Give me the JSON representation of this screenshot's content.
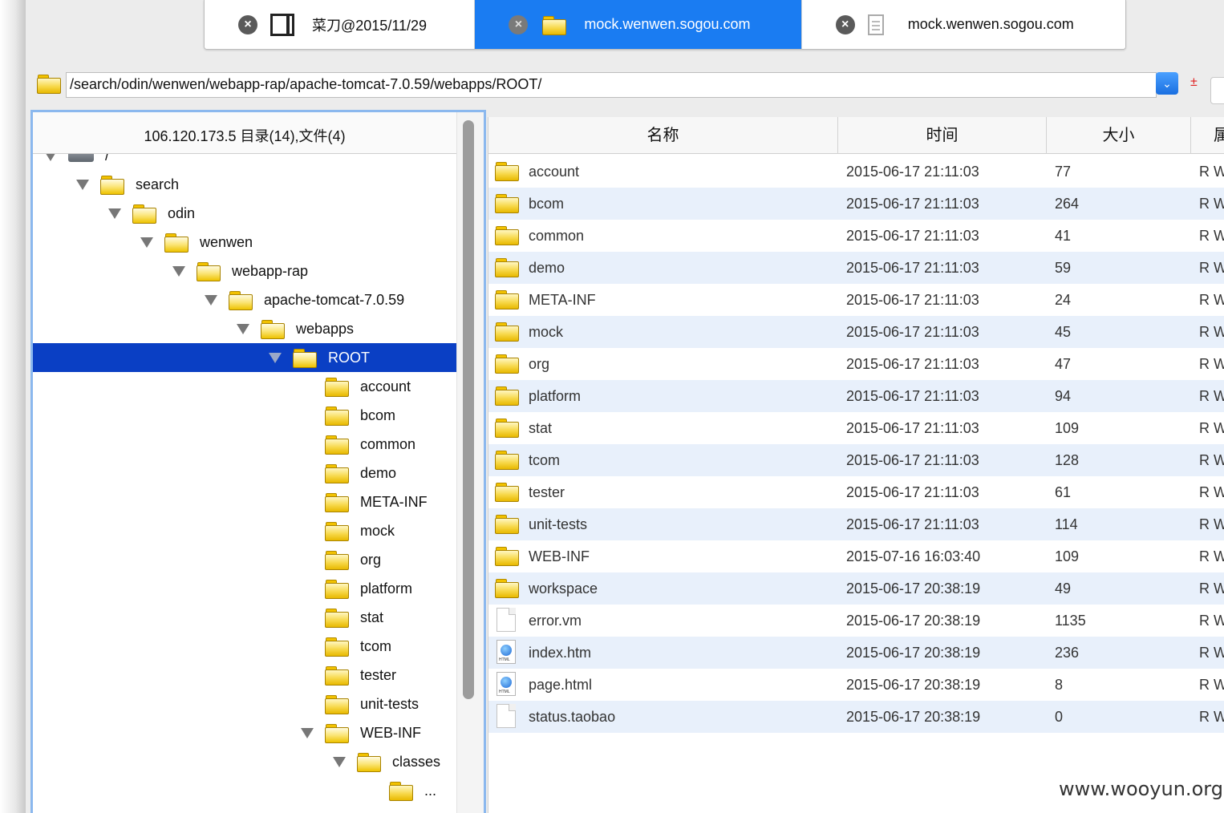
{
  "tabs": [
    {
      "label": "菜刀@2015/11/29",
      "icon": "window-icon",
      "active": false
    },
    {
      "label": "mock.wenwen.sogou.com",
      "icon": "folder-icon",
      "active": true
    },
    {
      "label": "mock.wenwen.sogou.com",
      "icon": "document-icon",
      "active": false
    }
  ],
  "address": {
    "path": "/search/odin/wenwen/webapp-rap/apache-tomcat-7.0.59/webapps/ROOT/",
    "dropdown_glyph": "⌄",
    "plus_glyph": "±"
  },
  "left_panel": {
    "header": "106.120.173.5    目录(14),文件(4)",
    "tree": [
      {
        "label": "/",
        "depth": 0,
        "expanded": true,
        "kind": "server"
      },
      {
        "label": "search",
        "depth": 1,
        "expanded": true
      },
      {
        "label": "odin",
        "depth": 2,
        "expanded": true
      },
      {
        "label": "wenwen",
        "depth": 3,
        "expanded": true
      },
      {
        "label": "webapp-rap",
        "depth": 4,
        "expanded": true
      },
      {
        "label": "apache-tomcat-7.0.59",
        "depth": 5,
        "expanded": true
      },
      {
        "label": "webapps",
        "depth": 6,
        "expanded": true
      },
      {
        "label": "ROOT",
        "depth": 7,
        "expanded": true,
        "selected": true
      },
      {
        "label": "account",
        "depth": 8
      },
      {
        "label": "bcom",
        "depth": 8
      },
      {
        "label": "common",
        "depth": 8
      },
      {
        "label": "demo",
        "depth": 8
      },
      {
        "label": "META-INF",
        "depth": 8
      },
      {
        "label": "mock",
        "depth": 8
      },
      {
        "label": "org",
        "depth": 8
      },
      {
        "label": "platform",
        "depth": 8
      },
      {
        "label": "stat",
        "depth": 8
      },
      {
        "label": "tcom",
        "depth": 8
      },
      {
        "label": "tester",
        "depth": 8
      },
      {
        "label": "unit-tests",
        "depth": 8
      },
      {
        "label": "WEB-INF",
        "depth": 8,
        "expanded": true
      },
      {
        "label": "classes",
        "depth": 9,
        "expanded": true
      },
      {
        "label": "...",
        "depth": 10
      }
    ]
  },
  "grid": {
    "columns": [
      "名称",
      "时间",
      "大小",
      "属"
    ],
    "rows": [
      {
        "name": "account",
        "time": "2015-06-17 21:11:03",
        "size": "77",
        "perm": "R W",
        "type": "folder"
      },
      {
        "name": "bcom",
        "time": "2015-06-17 21:11:03",
        "size": "264",
        "perm": "R W",
        "type": "folder"
      },
      {
        "name": "common",
        "time": "2015-06-17 21:11:03",
        "size": "41",
        "perm": "R W",
        "type": "folder"
      },
      {
        "name": "demo",
        "time": "2015-06-17 21:11:03",
        "size": "59",
        "perm": "R W",
        "type": "folder"
      },
      {
        "name": "META-INF",
        "time": "2015-06-17 21:11:03",
        "size": "24",
        "perm": "R W",
        "type": "folder"
      },
      {
        "name": "mock",
        "time": "2015-06-17 21:11:03",
        "size": "45",
        "perm": "R W",
        "type": "folder"
      },
      {
        "name": "org",
        "time": "2015-06-17 21:11:03",
        "size": "47",
        "perm": "R W",
        "type": "folder"
      },
      {
        "name": "platform",
        "time": "2015-06-17 21:11:03",
        "size": "94",
        "perm": "R W",
        "type": "folder"
      },
      {
        "name": "stat",
        "time": "2015-06-17 21:11:03",
        "size": "109",
        "perm": "R W",
        "type": "folder"
      },
      {
        "name": "tcom",
        "time": "2015-06-17 21:11:03",
        "size": "128",
        "perm": "R W",
        "type": "folder"
      },
      {
        "name": "tester",
        "time": "2015-06-17 21:11:03",
        "size": "61",
        "perm": "R W",
        "type": "folder"
      },
      {
        "name": "unit-tests",
        "time": "2015-06-17 21:11:03",
        "size": "114",
        "perm": "R W",
        "type": "folder"
      },
      {
        "name": "WEB-INF",
        "time": "2015-07-16 16:03:40",
        "size": "109",
        "perm": "R W",
        "type": "folder"
      },
      {
        "name": "workspace",
        "time": "2015-06-17 20:38:19",
        "size": "49",
        "perm": "R W",
        "type": "folder"
      },
      {
        "name": "error.vm",
        "time": "2015-06-17 20:38:19",
        "size": "1135",
        "perm": "R W",
        "type": "file"
      },
      {
        "name": "index.htm",
        "time": "2015-06-17 20:38:19",
        "size": "236",
        "perm": "R W",
        "type": "html"
      },
      {
        "name": "page.html",
        "time": "2015-06-17 20:38:19",
        "size": "8",
        "perm": "R W",
        "type": "html"
      },
      {
        "name": "status.taobao",
        "time": "2015-06-17 20:38:19",
        "size": "0",
        "perm": "R W",
        "type": "file"
      }
    ]
  },
  "watermark": "www.wooyun.org",
  "colors": {
    "active_tab": "#1a7cf2",
    "selected_tree": "#0a3fc4",
    "row_alt": "#e8f0fb"
  }
}
